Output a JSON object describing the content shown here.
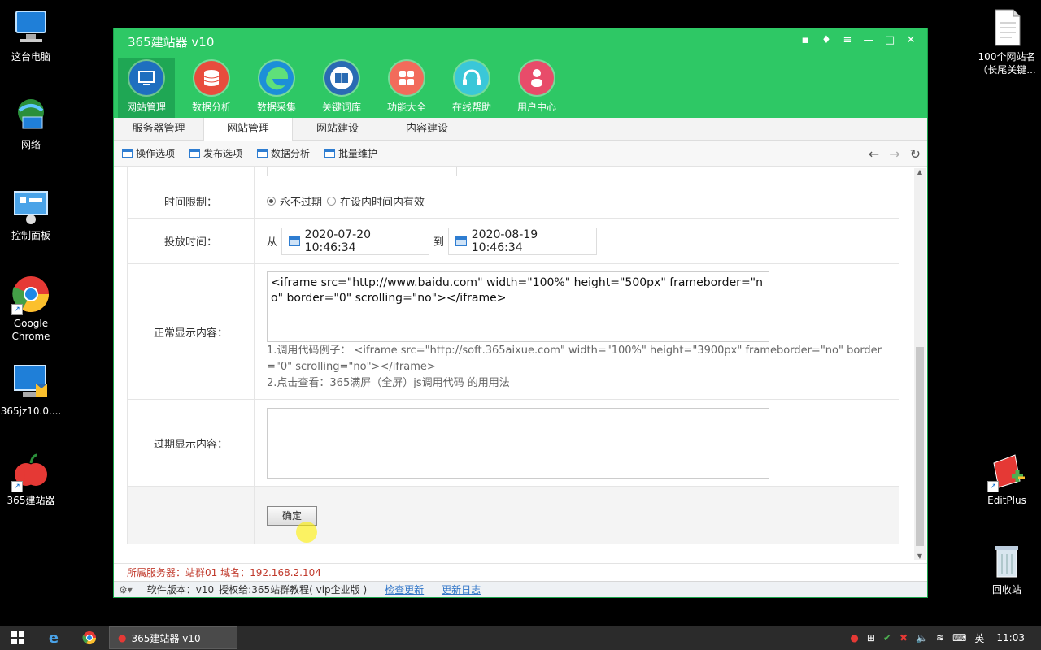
{
  "desktop": {
    "left_icons": [
      {
        "label": "这台电脑",
        "icon": "computer-icon"
      },
      {
        "label": "网络",
        "icon": "network-icon"
      },
      {
        "label": "控制面板",
        "icon": "control-panel-icon"
      },
      {
        "label": "Google Chrome",
        "icon": "chrome-icon"
      },
      {
        "label": "365jz10.0....",
        "icon": "installer-icon"
      },
      {
        "label": "365建站器",
        "icon": "apple-icon"
      }
    ],
    "right_icons": [
      {
        "label": "100个网站名（长尾关键...",
        "icon": "text-file-icon"
      },
      {
        "label": "EditPlus",
        "icon": "editplus-icon"
      },
      {
        "label": "回收站",
        "icon": "recycle-bin-icon"
      }
    ]
  },
  "window": {
    "title": "365建站器 v10",
    "toolbar": [
      {
        "label": "网站管理",
        "icon": "monitor-icon",
        "color": "#1e6fbf"
      },
      {
        "label": "数据分析",
        "icon": "database-icon",
        "color": "#e84c3d"
      },
      {
        "label": "数据采集",
        "icon": "edge-icon",
        "color": "#1c8fd8"
      },
      {
        "label": "关键词库",
        "icon": "book-icon",
        "color": "#2a6bb3"
      },
      {
        "label": "功能大全",
        "icon": "grid-icon",
        "color": "#f26b5b"
      },
      {
        "label": "在线帮助",
        "icon": "headset-icon",
        "color": "#3ac7d8"
      },
      {
        "label": "用户中心",
        "icon": "user-icon",
        "color": "#e84c6a"
      }
    ],
    "tabs": [
      "服务器管理",
      "网站管理",
      "网站建设",
      "内容建设"
    ],
    "subtools": [
      "操作选项",
      "发布选项",
      "数据分析",
      "批量维护"
    ],
    "form": {
      "time_limit_label": "时间限制：",
      "radio_never": "永不过期",
      "radio_within": "在设内时间内有效",
      "serve_time_label": "投放时间：",
      "from_text": "从",
      "to_text": "到",
      "start_time": "2020-07-20 10:46:34",
      "end_time": "2020-08-19 10:46:34",
      "normal_label": "正常显示内容：",
      "normal_content": "<iframe src=\"http://www.baidu.com\" width=\"100%\" height=\"500px\" frameborder=\"no\" border=\"0\" scrolling=\"no\"></iframe>",
      "hint1": "1.调用代码例子： <iframe src=\"http://soft.365aixue.com\" width=\"100%\" height=\"3900px\" frameborder=\"no\" border=\"0\" scrolling=\"no\"></iframe>",
      "hint2": "2.点击查看：365满屏（全屏）js调用代码 的用用法",
      "expired_label": "过期显示内容：",
      "expired_content": "",
      "submit_label": "确定"
    },
    "status": {
      "server_info": "所属服务器：站群01 域名：192.168.2.104",
      "version": "软件版本：v10",
      "license": "授权给:365站群教程( vip企业版 )",
      "check_update": "检查更新",
      "changelog": "更新日志"
    }
  },
  "taskbar": {
    "app_label": "365建站器 v10",
    "ime": "英",
    "clock": "11:03"
  }
}
